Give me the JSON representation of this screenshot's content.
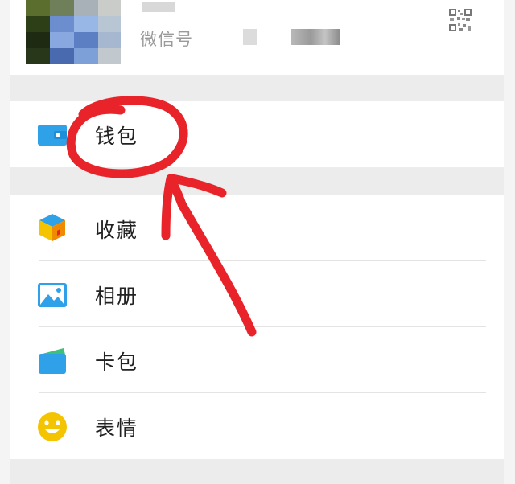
{
  "profile": {
    "wechat_id_label": "微信号",
    "qr_icon": "qr-code-icon"
  },
  "menu": {
    "wallet": {
      "label": "钱包",
      "icon": "wallet-icon",
      "color": "#2fa1e8"
    },
    "items": [
      {
        "label": "收藏",
        "icon": "favorites-cube-icon"
      },
      {
        "label": "相册",
        "icon": "album-picture-icon"
      },
      {
        "label": "卡包",
        "icon": "card-pack-icon"
      },
      {
        "label": "表情",
        "icon": "sticker-smiley-icon"
      }
    ]
  },
  "colors": {
    "separator": "#ececec",
    "annotation": "#e8242a",
    "accent_blue": "#2fa1e8",
    "accent_yellow": "#f5c400"
  }
}
